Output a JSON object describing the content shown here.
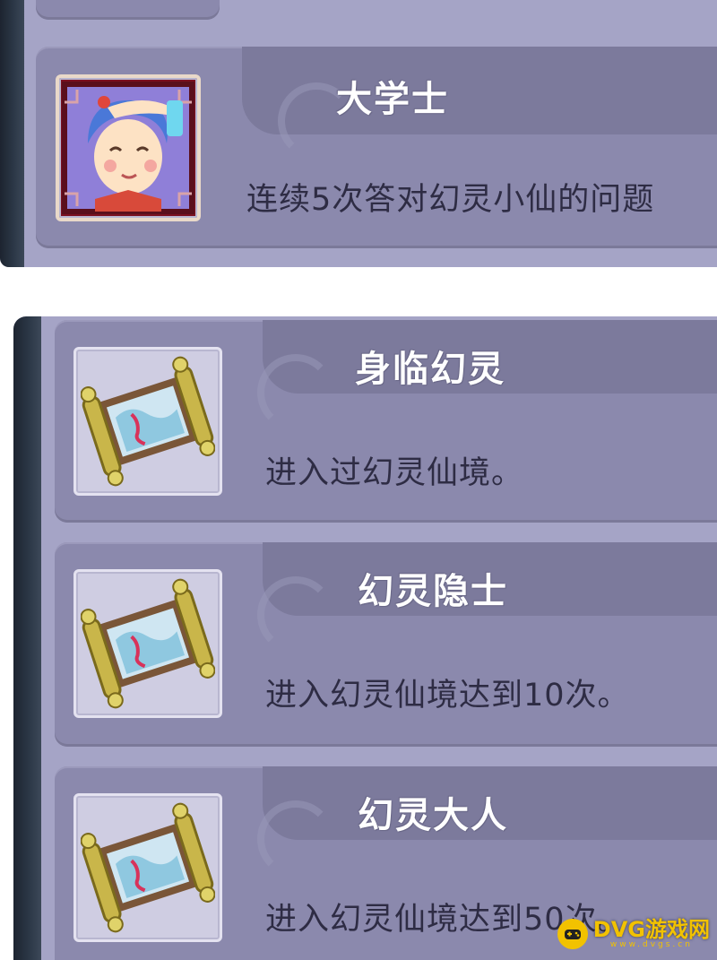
{
  "top_panel": {
    "achievements": [
      {
        "title": "大学士",
        "description": "连续5次答对幻灵小仙的问题",
        "icon": "scholar-portrait-icon"
      }
    ]
  },
  "bottom_panel": {
    "achievements": [
      {
        "title": "身临幻灵",
        "description": "进入过幻灵仙境。",
        "icon": "scroll-painting-icon"
      },
      {
        "title": "幻灵隐士",
        "description": "进入幻灵仙境达到10次。",
        "icon": "scroll-painting-icon"
      },
      {
        "title": "幻灵大人",
        "description": "进入幻灵仙境达到50次。",
        "icon": "scroll-painting-icon"
      }
    ]
  },
  "watermark": {
    "text": "DVG游戏网",
    "subtext": "www.dvgs.cn"
  },
  "colors": {
    "panel": "#a5a4c6",
    "card": "#8b89ad",
    "title_text": "#ffffff",
    "description_text": "#2e2c44",
    "watermark": "#f2c200"
  }
}
